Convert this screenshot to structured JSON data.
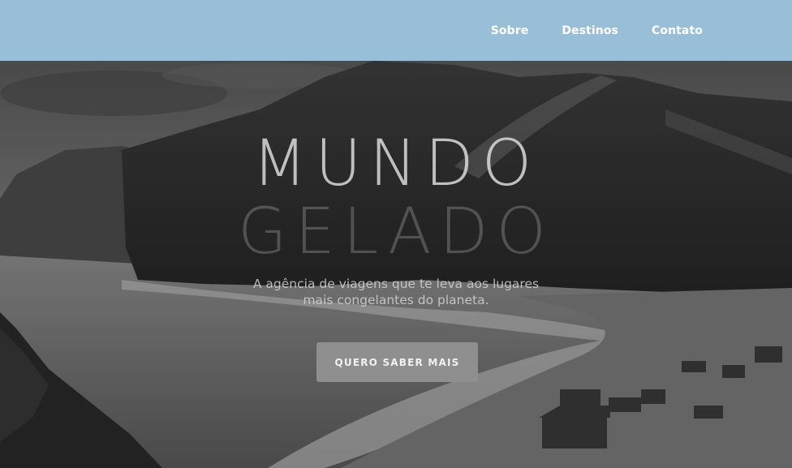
{
  "nav": {
    "items": [
      {
        "label": "Sobre"
      },
      {
        "label": "Destinos"
      },
      {
        "label": "Contato"
      }
    ]
  },
  "hero": {
    "title_line1": "MUNDO",
    "title_line2": "GELADO",
    "subtitle_line1": "A agência de viagens que te leva aos lugares",
    "subtitle_line2": "mais congelantes do planeta.",
    "cta_label": "QUERO SABER MAIS",
    "background": "grayscale landscape photo of snowy mountains over a frozen lake"
  },
  "colors": {
    "topbar": "#98bfd7",
    "nav_text": "#ffffff",
    "button_bg": "#8f8f8f"
  }
}
